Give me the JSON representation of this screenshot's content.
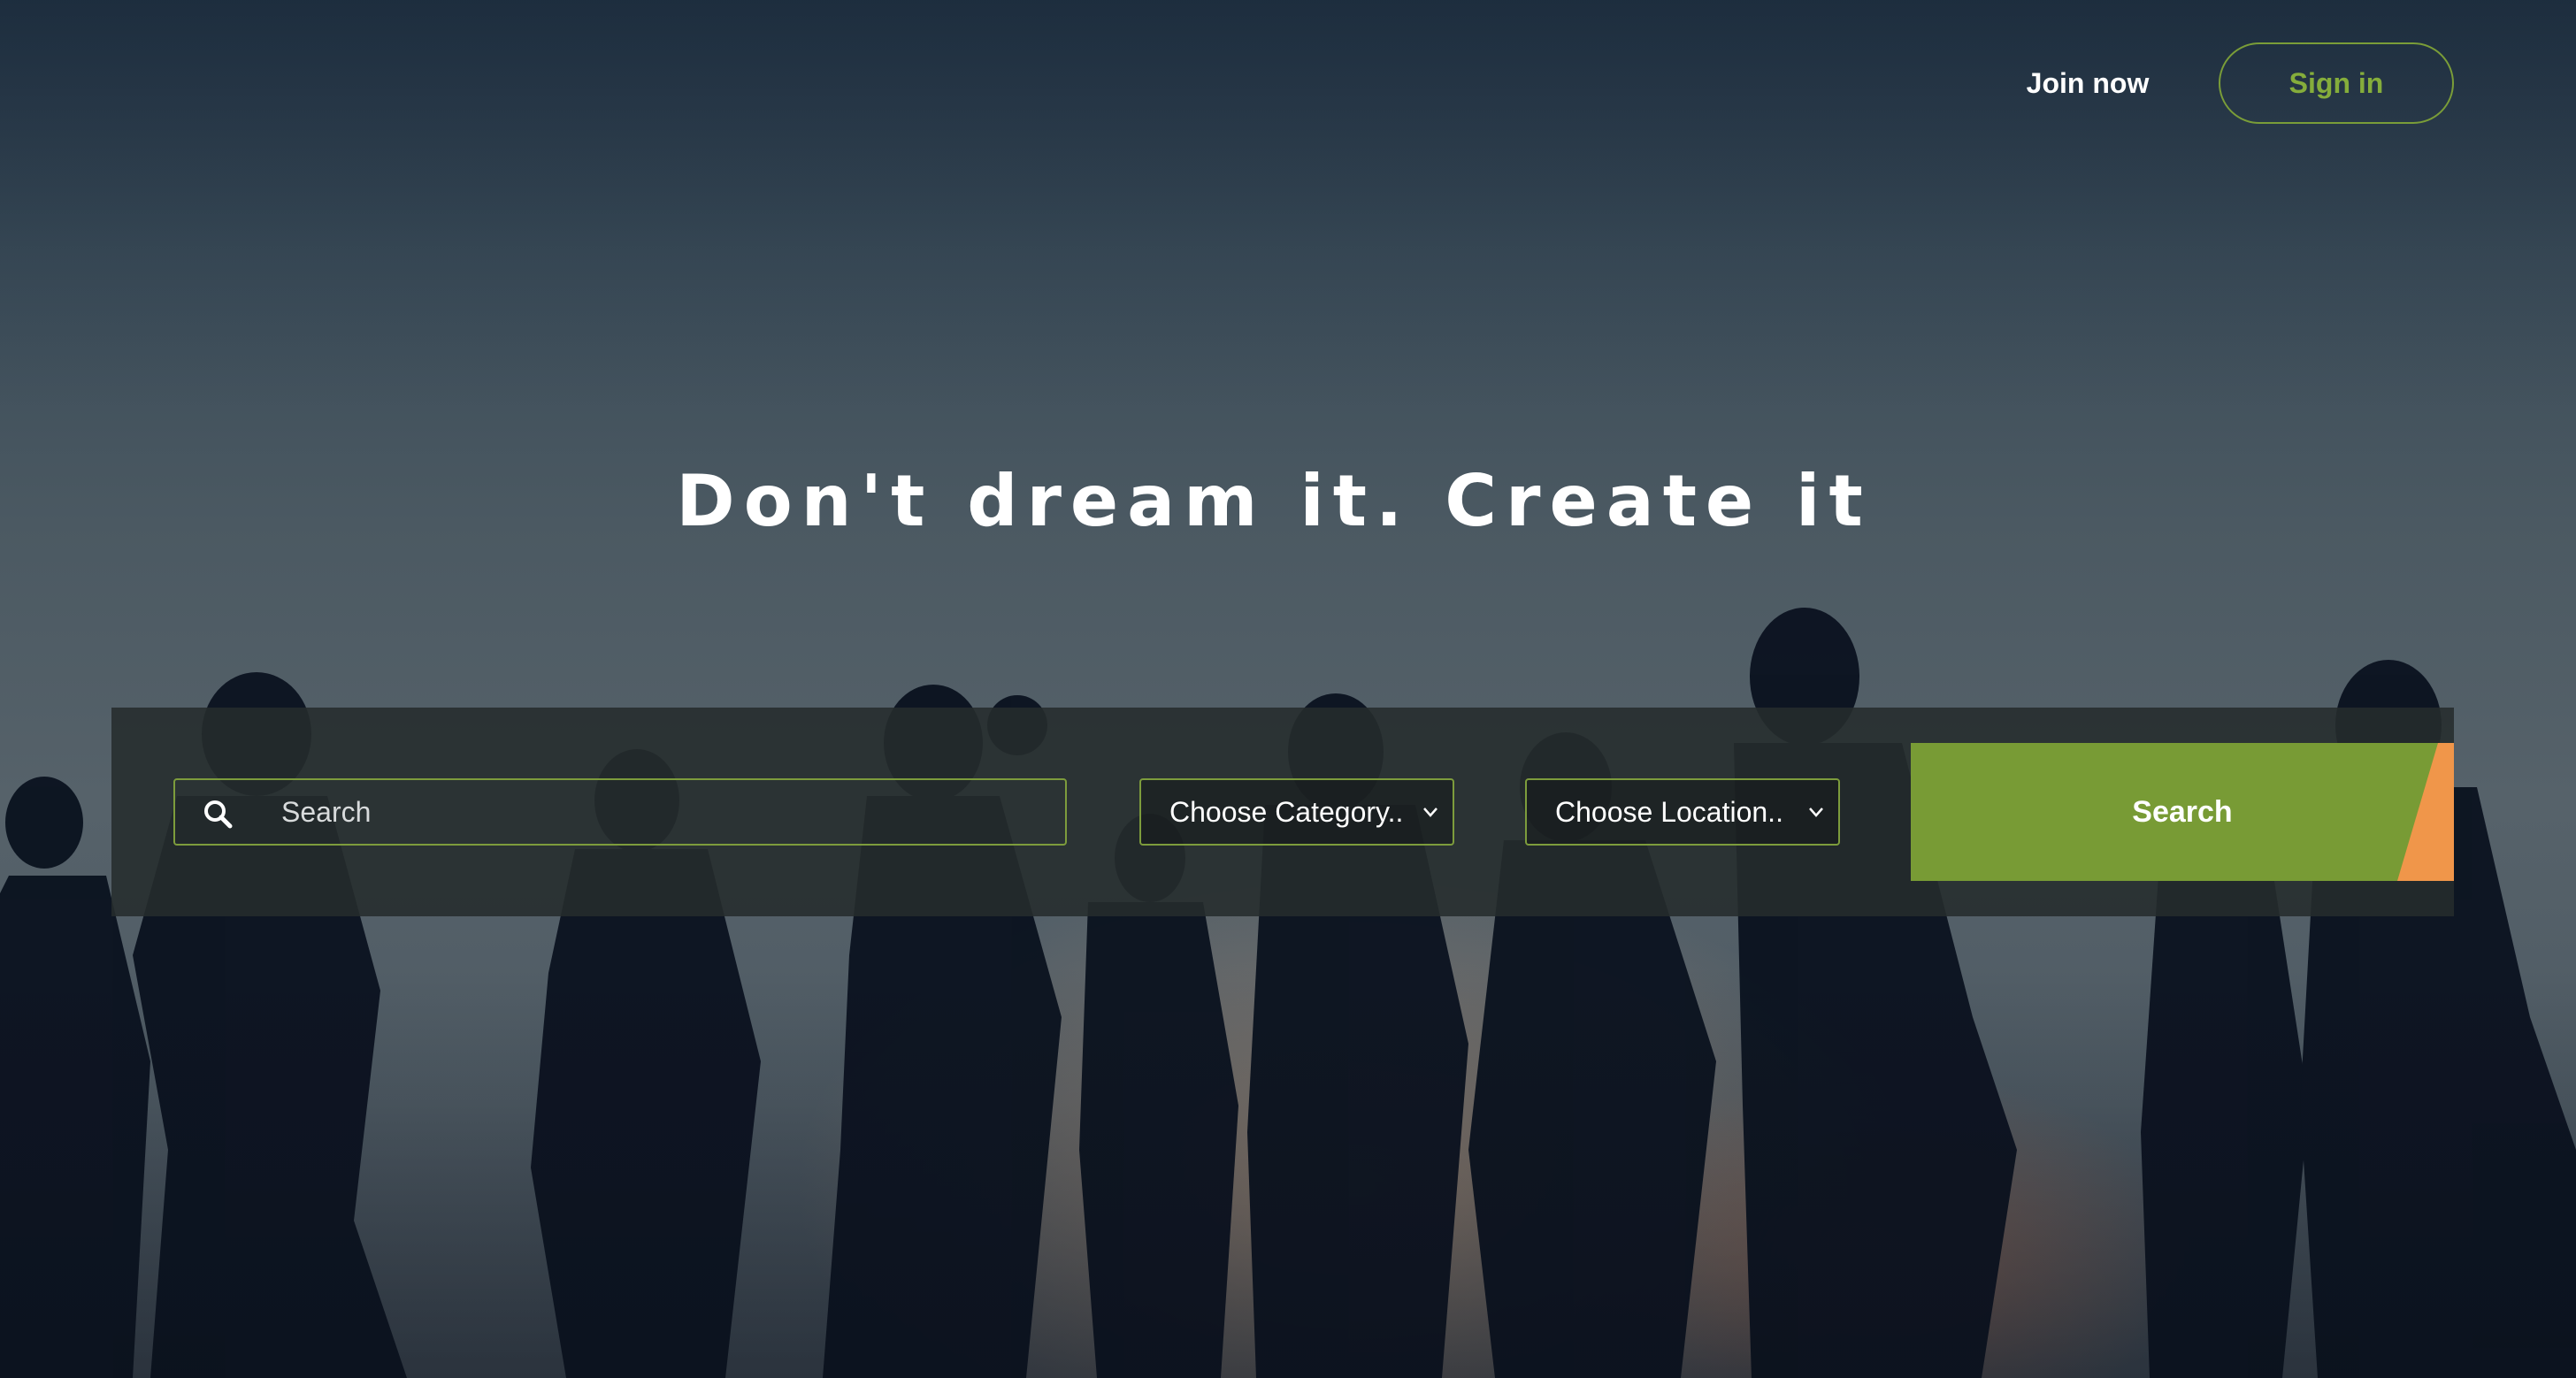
{
  "nav": {
    "join_label": "Join now",
    "signin_label": "Sign in"
  },
  "hero": {
    "headline": "Don't dream it. Create it"
  },
  "search": {
    "placeholder": "Search",
    "category_value": "Choose Category..",
    "location_value": "Choose Location..",
    "button_label": "Search"
  },
  "colors": {
    "accent_green": "#789b35",
    "accent_orange": "#f0964a",
    "outline_green": "#7d9c3c"
  }
}
